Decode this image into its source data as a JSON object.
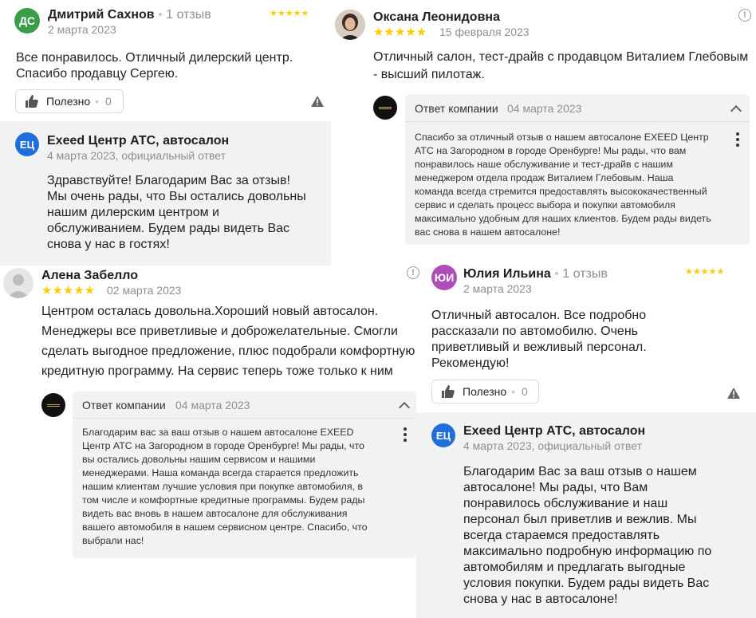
{
  "r1": {
    "initials": "ДС",
    "avatar_color": "#3b9c4a",
    "name": "Дмитрий Сахнов",
    "dot": "•",
    "reviews": "1 отзыв",
    "stars": "★★★★★",
    "date": "2 марта 2023",
    "text_lines": [
      "Все понравилось. Отличный дилерский центр.",
      "Спасибо продавцу Сергею."
    ],
    "helpful_label": "Полезно",
    "helpful_sep": "•",
    "helpful_count": "0",
    "owner": {
      "initials": "ЕЦ",
      "name": "Exeed Центр АТС, автосалон",
      "date": "4 марта 2023, официальный ответ",
      "text_lines": [
        "Здравствуйте! Благодарим Вас за отзыв!",
        "Мы очень рады, что Вы остались довольны",
        "нашим дилерским центром и",
        "обслуживанием. Будем рады видеть Вас",
        "снова у нас в гостях!"
      ]
    }
  },
  "r2": {
    "name": "Оксана Леонидовна",
    "stars": "★★★★★",
    "date": "15 февраля 2023",
    "info": "!",
    "text_lines": [
      "Отличный салон, тест-драйв с продавцом Виталием Глебовым",
      "- высший пилотаж."
    ],
    "reply": {
      "label": "Ответ компании",
      "date": "04 марта 2023",
      "text_lines": [
        "Спасибо за отличный отзыв о нашем автосалоне EXEED Центр",
        "АТС на Загородном в городе Оренбурге! Мы рады, что вам",
        "понравилось наше обслуживание и тест-драйв с нашим",
        "менеджером отдела продаж Виталием Глебовым. Наша",
        "команда всегда стремится предоставлять высококачественный",
        "сервис и сделать процесс выбора и покупки автомобиля",
        "максимально удобным для наших клиентов. Будем рады видеть",
        "вас снова в нашем автосалоне!"
      ]
    }
  },
  "r3": {
    "name": "Алена Забелло",
    "stars": "★★★★★",
    "date": "02 марта 2023",
    "text_lines": [
      "Центром осталась довольна.Хороший новый автосалон.",
      "Менеджеры все приветливые и доброжелательные. Смогли",
      "сделать выгодное предложение, плюс подобрали комфортную",
      "кредитную программу. На сервис теперь тоже только к ним"
    ],
    "reply": {
      "label": "Ответ компании",
      "date": "04 марта 2023",
      "text_lines": [
        "Благодарим вас за ваш отзыв о нашем автосалоне EXEED",
        "Центр АТС на Загородном в городе Оренбурге! Мы рады, что",
        "вы остались довольны нашим сервисом и нашими",
        "менеджерами. Наша команда всегда старается предложить",
        "нашим клиентам лучшие условия при покупке автомобиля, в",
        "том числе и комфортные кредитные программы. Будем рады",
        "видеть вас вновь в нашем автосалоне для обслуживания",
        "вашего автомобиля в нашем сервисном центре. Спасибо, что",
        "выбрали нас!"
      ]
    }
  },
  "r4": {
    "initials": "ЮИ",
    "avatar_color": "#b04cb8",
    "name": "Юлия Ильина",
    "dot": "•",
    "reviews": "1 отзыв",
    "stars": "★★★★★",
    "date": "2 марта 2023",
    "info": "!",
    "text_lines": [
      "Отличный автосалон. Все подробно",
      "рассказали по автомобилю. Очень",
      "приветливый и вежливый персонал.",
      "Рекомендую!"
    ],
    "helpful_label": "Полезно",
    "helpful_sep": "•",
    "helpful_count": "0",
    "owner": {
      "initials": "ЕЦ",
      "name": "Exeed Центр АТС, автосалон",
      "date": "4 марта 2023, официальный ответ",
      "text_lines": [
        "Благодарим Вас за ваш отзыв о нашем",
        "автосалоне! Мы рады, что Вам",
        "понравилось обслуживание и наш",
        "персонал был приветлив и вежлив. Мы",
        "всегда стараемся предоставлять",
        "максимально подробную информацию по",
        "автомобилям и предлагать выгодные",
        "условия покупки. Будем рады видеть Вас",
        "снова у нас в автосалоне!"
      ]
    }
  }
}
